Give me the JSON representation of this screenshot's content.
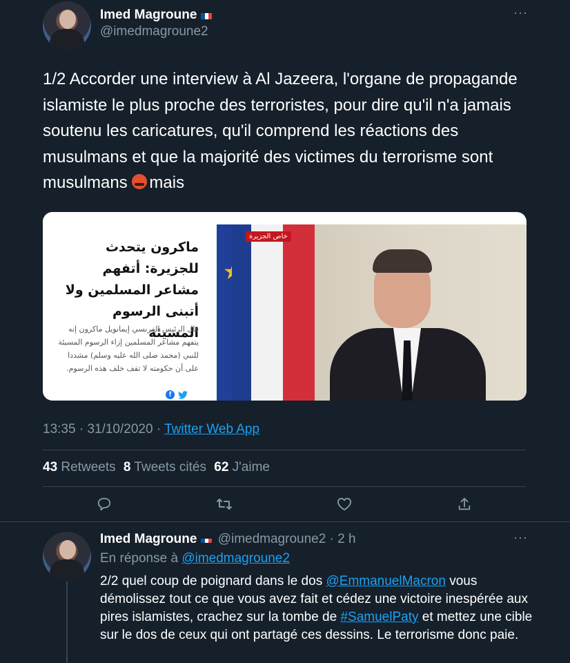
{
  "tweet": {
    "author_name": "Imed Magroune",
    "author_handle": "@imedmagroune2",
    "text": "1/2 Accorder une interview à Al Jazeera, l'organe de propagande islamiste le plus proche des terroristes, pour dire qu'il n'a jamais soutenu les caricatures, qu'il comprend les réactions des musulmans et que la majorité des victimes du terrorisme sont musulmans",
    "text_tail": "mais",
    "emoji": "cursing-face-emoji",
    "time": "13:35",
    "date": "31/10/2020",
    "source": "Twitter Web App",
    "retweets_count": "43",
    "retweets_label": "Retweets",
    "quotes_count": "8",
    "quotes_label": "Tweets cités",
    "likes_count": "62",
    "likes_label": "J'aime"
  },
  "card": {
    "headline": "ماكرون يتحدث للجزيرة: أتفهم مشاعر المسلمين ولا أتبنى الرسوم المسيئة",
    "body": "قال الرئيس الفرنسي إيمانويل ماكرون إنه يتفهم مشاعر المسلمين إزاء الرسوم المسيئة للنبي (محمد صلى الله عليه وسلم) مشددا على أن حكومته لا تقف خلف هذه الرسوم.",
    "badge": "خاص الجزيرة"
  },
  "reply": {
    "author_name": "Imed Magroune",
    "author_handle": "@imedmagroune2",
    "age": "2 h",
    "in_reply_prefix": "En réponse à",
    "in_reply_handle": "@imedmagroune2",
    "text_1": "2/2 quel coup de poignard dans le dos",
    "mention": "@EmmanuelMacron",
    "text_2": "vous démolissez tout ce que vous avez fait et cédez une victoire inespérée aux pires islamistes, crachez sur la tombe de",
    "hashtag": "#SamuelPaty",
    "text_3": "et mettez une cible sur le dos de ceux qui ont partagé ces dessins. Le terrorisme donc paie."
  },
  "colors": {
    "background": "#15202b",
    "accent": "#1da1f2",
    "muted": "#8899a6",
    "divider": "#38444d"
  }
}
